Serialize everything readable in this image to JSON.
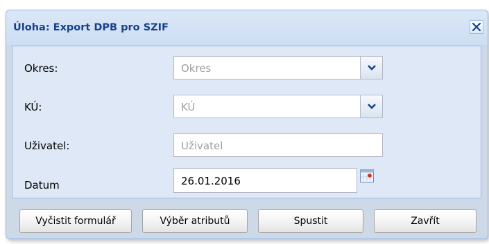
{
  "window": {
    "title": "Úloha: Export DPB pro SZIF"
  },
  "form": {
    "okres": {
      "label": "Okres:",
      "placeholder": "Okres"
    },
    "ku": {
      "label": "KÚ:",
      "placeholder": "KÚ"
    },
    "uzivatel": {
      "label": "Uživatel:",
      "placeholder": "Uživatel"
    },
    "datum": {
      "label": "Datum",
      "value": "26.01.2016"
    }
  },
  "buttons": {
    "clear": "Vyčistit formulář",
    "attributes": "Výběr atributů",
    "run": "Spustit",
    "close": "Zavřít"
  },
  "colors": {
    "title_text": "#15428b",
    "window_border": "#99bbe8",
    "panel_bg": "#dfe8f6"
  },
  "icons": {
    "close": "close-icon",
    "dropdown": "chevron-down-icon",
    "calendar": "calendar-icon"
  }
}
